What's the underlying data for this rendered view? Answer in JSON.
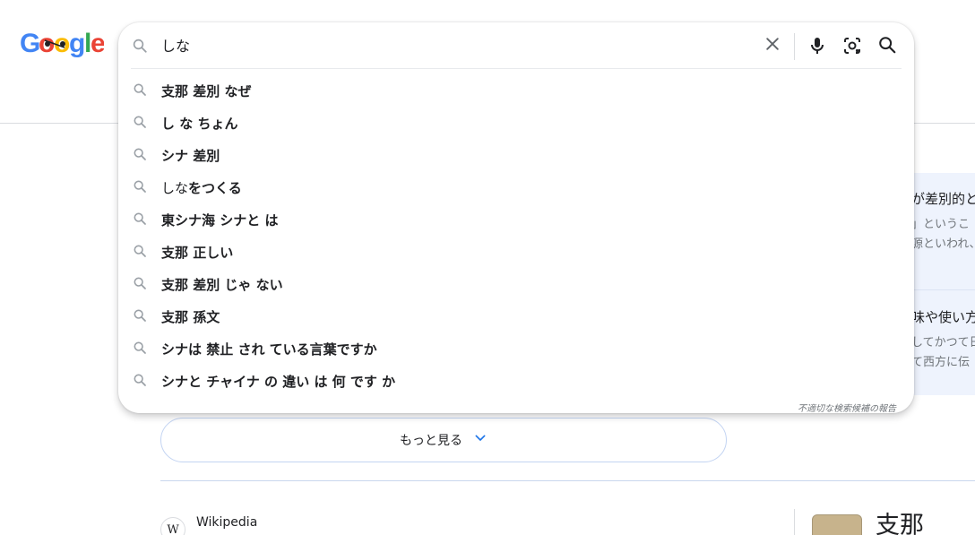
{
  "logo": {
    "alt": "Google",
    "letters": [
      "G",
      "o",
      "o",
      "g",
      "l",
      "e"
    ],
    "colors": [
      "#4285f4",
      "#ea4335",
      "#fbbc05",
      "#4285f4",
      "#34a853",
      "#ea4335"
    ]
  },
  "search": {
    "query": "しな",
    "suggestions": [
      {
        "typed": "",
        "completion": "支那 差別 なぜ"
      },
      {
        "typed": "",
        "completion": "し な ちょん"
      },
      {
        "typed": "",
        "completion": "シナ 差別"
      },
      {
        "typed": "しな",
        "completion": "をつくる"
      },
      {
        "typed": "",
        "completion": "東シナ海 シナと は"
      },
      {
        "typed": "",
        "completion": "支那 正しい"
      },
      {
        "typed": "",
        "completion": "支那 差別 じゃ ない"
      },
      {
        "typed": "",
        "completion": "支那 孫文"
      },
      {
        "typed": "",
        "completion": "シナは 禁止 され ている言葉ですか"
      },
      {
        "typed": "",
        "completion": "シナと チャイナ の 違い は 何 です か"
      }
    ],
    "report_label": "不適切な検索候補の報告"
  },
  "side_panel": {
    "q1_title": "が差別的と",
    "q1_line1": "」というこ",
    "q1_line2": "源といわれ、",
    "q2_title": "味や使い方",
    "q2_line1": "してかつて日",
    "q2_line2": "て西方に伝"
  },
  "more_button": {
    "label": "もっと見る"
  },
  "result": {
    "source": "Wikipedia",
    "favicon_letter": "W"
  },
  "knowledge_panel": {
    "title": "支那"
  },
  "colors": {
    "accent": "#1a73e8",
    "icon_gray": "#5f6368",
    "mic": "#202124"
  }
}
